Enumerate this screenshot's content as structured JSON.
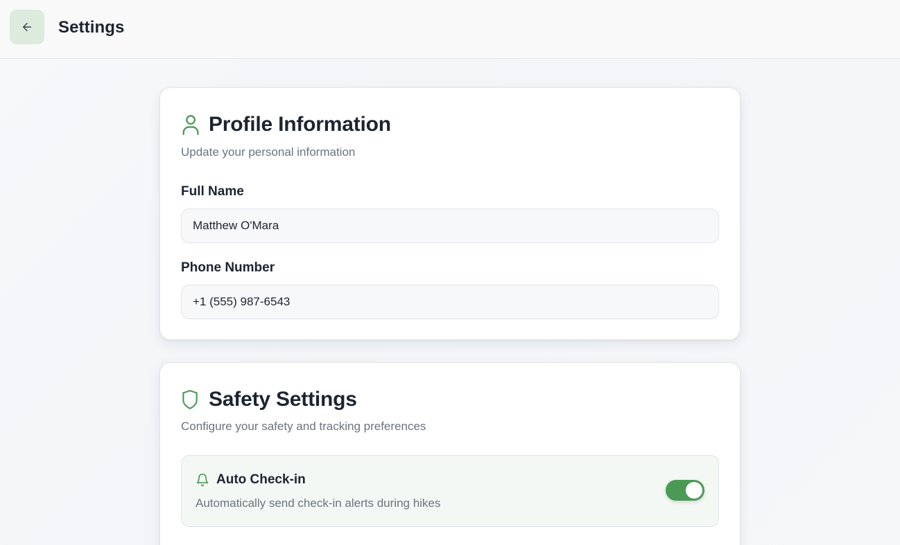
{
  "header": {
    "title": "Settings",
    "back_icon": "arrow-left-icon"
  },
  "colors": {
    "accent": "#4a9a56",
    "back_button_bg": "#dcebdd",
    "setting_row_bg": "#f3f8f4"
  },
  "profile": {
    "icon": "user-icon",
    "title": "Profile Information",
    "subtitle": "Update your personal information",
    "full_name_label": "Full Name",
    "full_name_value": "Matthew O'Mara",
    "phone_label": "Phone Number",
    "phone_value": "+1 (555) 987-6543"
  },
  "safety": {
    "icon": "shield-icon",
    "title": "Safety Settings",
    "subtitle": "Configure your safety and tracking preferences",
    "auto_checkin": {
      "icon": "bell-icon",
      "title": "Auto Check-in",
      "description": "Automatically send check-in alerts during hikes",
      "enabled": true
    }
  }
}
